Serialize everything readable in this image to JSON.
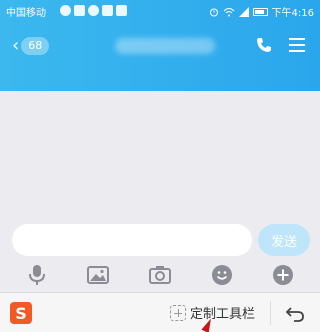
{
  "status_bar": {
    "carrier": "中国移动",
    "time": "下午4:16"
  },
  "header": {
    "back_count": "68",
    "back_icon": "chevron-left-icon",
    "call_icon": "phone-icon",
    "menu_icon": "menu-icon"
  },
  "composer": {
    "input_value": "",
    "send_label": "发送"
  },
  "toolbar": {
    "items": [
      "microphone-icon",
      "image-icon",
      "camera-icon",
      "emoji-icon",
      "plus-icon"
    ]
  },
  "ime": {
    "logo_text": "S",
    "custom_toolbar_label": "定制工具栏",
    "undo_icon": "undo-icon"
  },
  "colors": {
    "header": "#2aa6ec",
    "send_disabled": "#bfe5fb",
    "ime_logo": "#f05a24",
    "icon_gray": "#8c8c96"
  }
}
